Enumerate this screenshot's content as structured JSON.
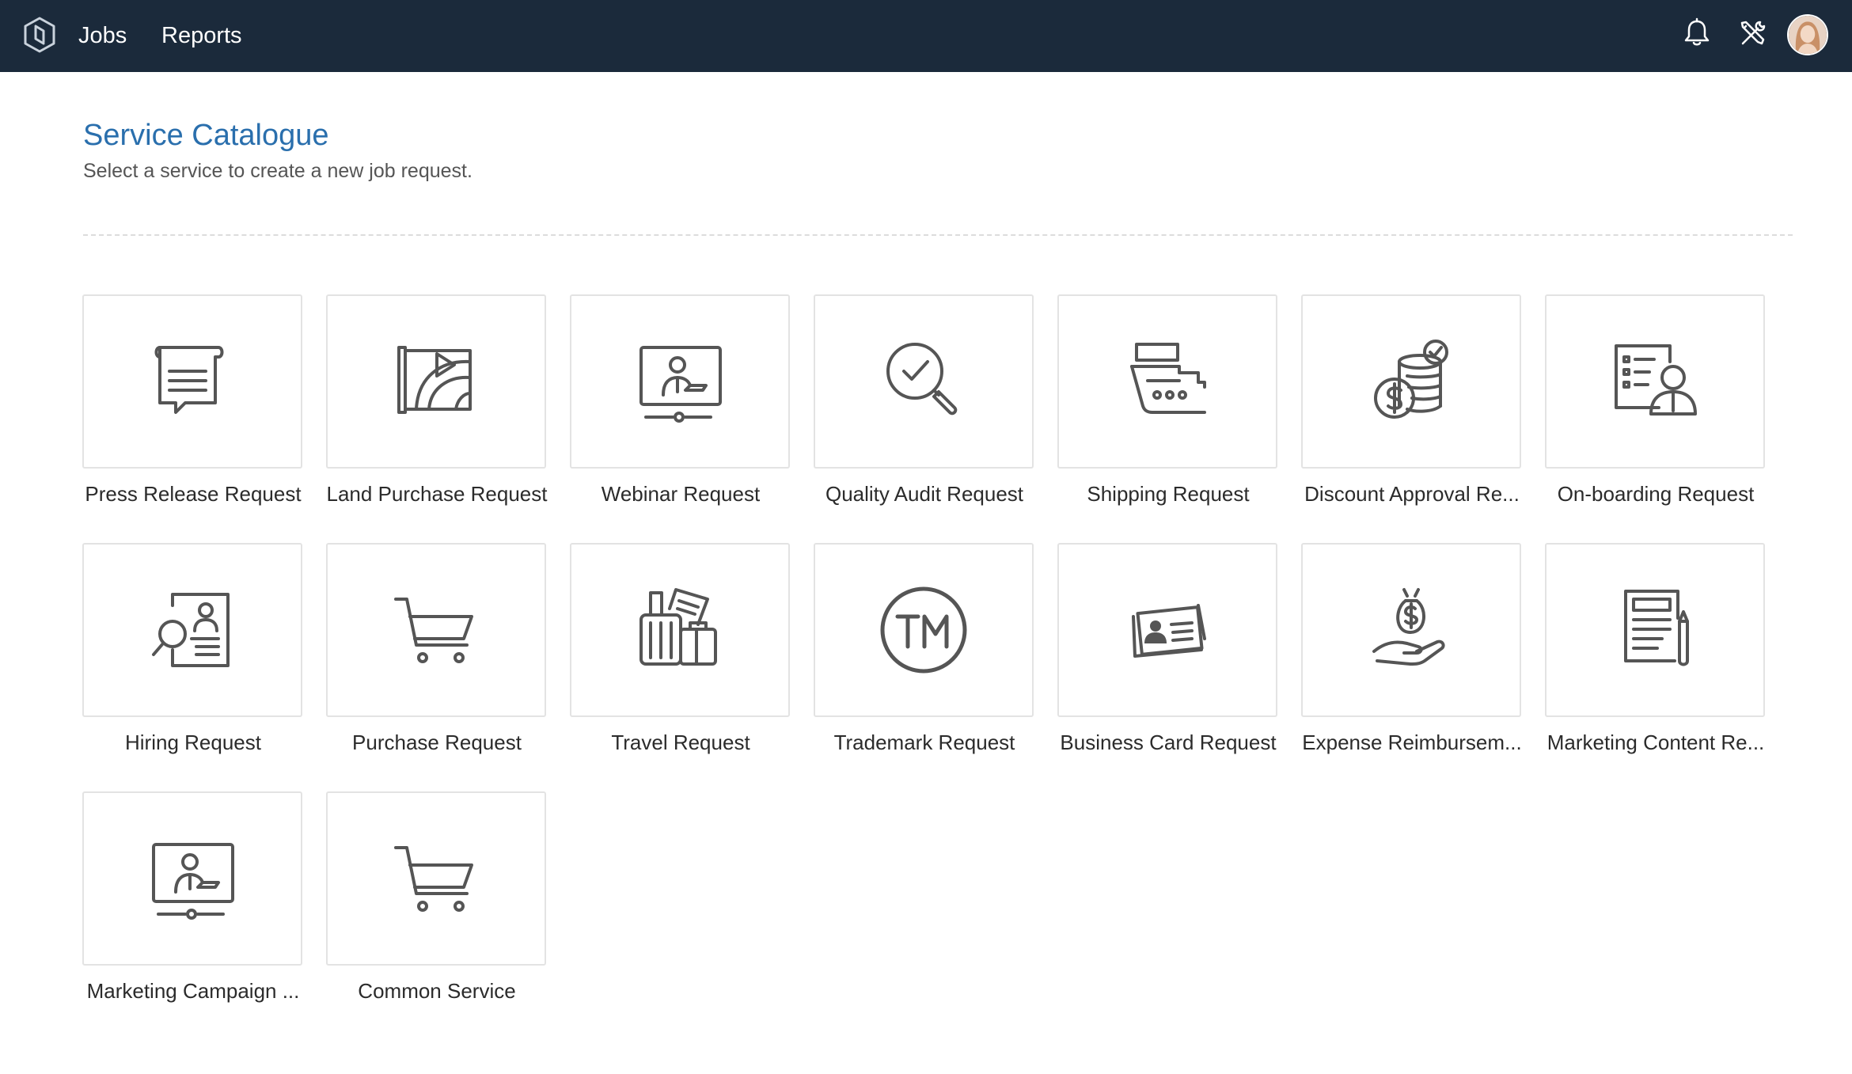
{
  "header": {
    "nav": [
      "Jobs",
      "Reports"
    ],
    "icons": [
      "logo-icon",
      "bell-icon",
      "tools-icon",
      "user-avatar"
    ]
  },
  "page": {
    "title": "Service Catalogue",
    "subtitle": "Select a service to create a new job request."
  },
  "services": [
    {
      "label": "Press Release Request",
      "icon": "press-release-icon"
    },
    {
      "label": "Land Purchase Request",
      "icon": "land-purchase-icon"
    },
    {
      "label": "Webinar Request",
      "icon": "webinar-icon"
    },
    {
      "label": "Quality Audit Request",
      "icon": "quality-audit-icon"
    },
    {
      "label": "Shipping Request",
      "icon": "shipping-icon"
    },
    {
      "label": "Discount Approval Re...",
      "icon": "discount-approval-icon"
    },
    {
      "label": "On-boarding Request",
      "icon": "onboarding-icon"
    },
    {
      "label": "Hiring Request",
      "icon": "hiring-icon"
    },
    {
      "label": "Purchase Request",
      "icon": "cart-icon"
    },
    {
      "label": "Travel Request",
      "icon": "travel-icon"
    },
    {
      "label": "Trademark Request",
      "icon": "trademark-icon"
    },
    {
      "label": "Business Card Request",
      "icon": "business-card-icon"
    },
    {
      "label": "Expense Reimbursem...",
      "icon": "expense-icon"
    },
    {
      "label": "Marketing Content Re...",
      "icon": "marketing-content-icon"
    },
    {
      "label": "Marketing Campaign ...",
      "icon": "webinar-icon"
    },
    {
      "label": "Common Service",
      "icon": "cart-icon"
    }
  ],
  "colors": {
    "topbar": "#1b2a3b",
    "title": "#2a6fad",
    "icon": "#555555",
    "card_border": "#e3e3e3"
  }
}
